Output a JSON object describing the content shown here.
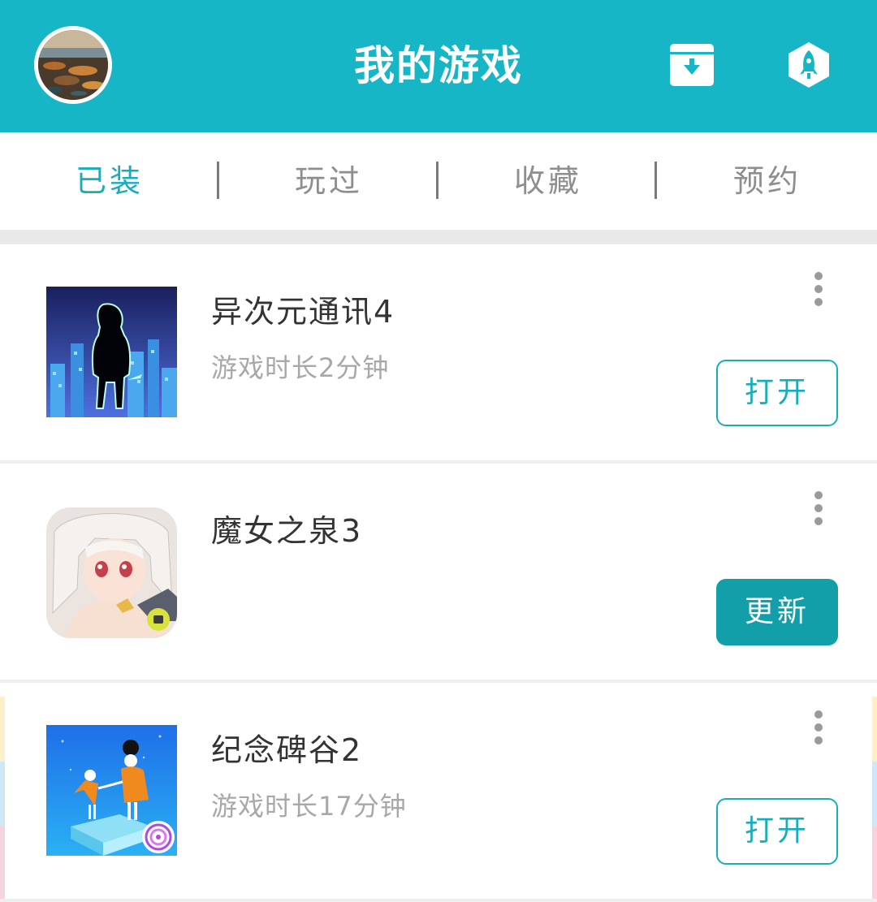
{
  "header": {
    "title": "我的游戏",
    "avatar_icon": "avatar-landscape",
    "download_icon": "download-box-icon",
    "rocket_icon": "rocket-icon",
    "accent_color": "#17b6c6"
  },
  "tabs": [
    {
      "label": "已装",
      "active": true
    },
    {
      "label": "玩过",
      "active": false
    },
    {
      "label": "收藏",
      "active": false
    },
    {
      "label": "预约",
      "active": false
    }
  ],
  "games": [
    {
      "name": "异次元通讯4",
      "playtime": "游戏时长2分钟",
      "action": "打开",
      "action_type": "open",
      "icon": "silhouette-city-icon"
    },
    {
      "name": "魔女之泉3",
      "playtime": "",
      "action": "更新",
      "action_type": "update",
      "icon": "anime-girl-icon"
    },
    {
      "name": "纪念碑谷2",
      "playtime": "游戏时长17分钟",
      "action": "打开",
      "action_type": "open",
      "icon": "monument-valley-icon"
    }
  ]
}
